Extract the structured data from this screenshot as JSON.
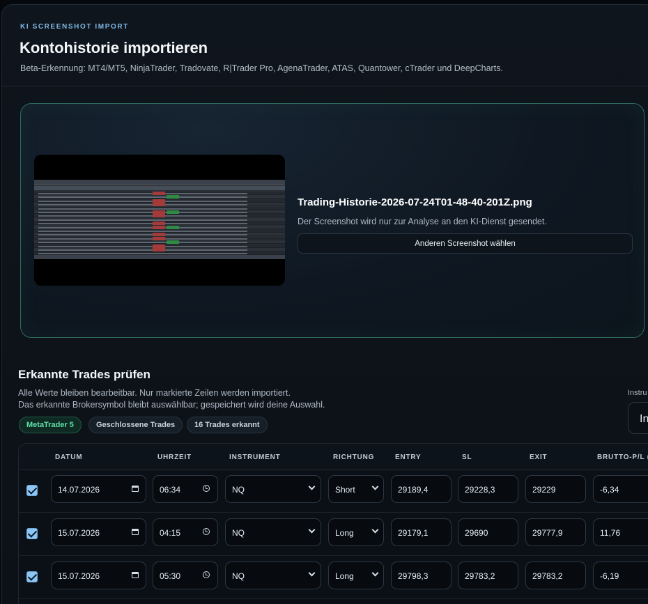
{
  "header": {
    "eyebrow": "KI SCREENSHOT IMPORT",
    "title": "Kontohistorie importieren",
    "subtitle": "Beta-Erkennung: MT4/MT5, NinjaTrader, Tradovate, R|Trader Pro, AgenaTrader, ATAS, Quantower, cTrader und DeepCharts."
  },
  "upload": {
    "file_name": "Trading-Historie-2026-07-24T01-48-40-201Z.png",
    "hint": "Der Screenshot wird nur zur Analyse an den KI-Dienst gesendet.",
    "choose_label": "Anderen Screenshot wählen"
  },
  "review": {
    "title": "Erkannte Trades prüfen",
    "line1": "Alle Werte bleiben bearbeitbar. Nur markierte Zeilen werden importiert.",
    "line2": "Das erkannte Brokersymbol bleibt auswählbar; gespeichert wird deine Auswahl.",
    "badges": [
      "MetaTrader 5",
      "Geschlossene Trades",
      "16 Trades erkannt"
    ],
    "instrument_label": "Instru",
    "instrument_value": "In"
  },
  "table": {
    "headers": [
      "DATUM",
      "UHRZEIT",
      "INSTRUMENT",
      "RICHTUNG",
      "ENTRY",
      "SL",
      "EXIT",
      "BRUTTO-P/L ($)"
    ],
    "rows": [
      {
        "checked": true,
        "date": "14.07.2026",
        "time": "06:34",
        "instrument": "NQ",
        "direction": "Short",
        "entry": "29189,4",
        "sl": "29228,3",
        "exit": "29229",
        "pl": "-6,34"
      },
      {
        "checked": true,
        "date": "15.07.2026",
        "time": "04:15",
        "instrument": "NQ",
        "direction": "Long",
        "entry": "29179,1",
        "sl": "29690",
        "exit": "29777,9",
        "pl": "11,76"
      },
      {
        "checked": true,
        "date": "15.07.2026",
        "time": "05:30",
        "instrument": "NQ",
        "direction": "Long",
        "entry": "29798,3",
        "sl": "29783,2",
        "exit": "29783,2",
        "pl": "-6,19"
      }
    ]
  }
}
